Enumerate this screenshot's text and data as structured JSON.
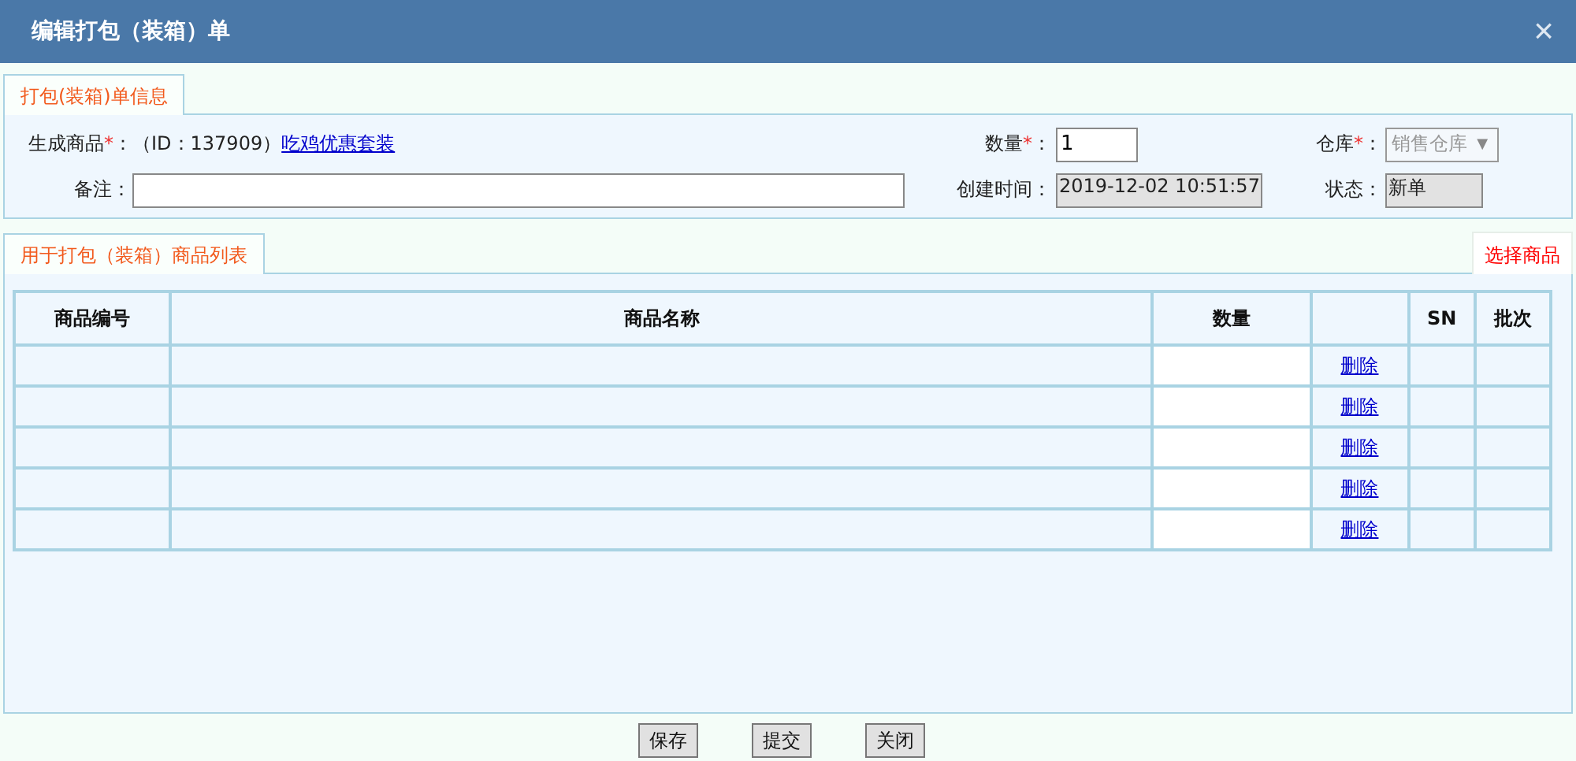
{
  "window": {
    "title": "编辑打包（装箱）单",
    "close": "×"
  },
  "info_tab": {
    "label": "打包(装箱)单信息",
    "selected": true
  },
  "product": {
    "label": "生成商品",
    "mark": "*",
    "sep": "：",
    "id_text": "（ID：137909）",
    "link": "吃鸡优惠套装"
  },
  "quantity": {
    "label": "数量",
    "mark": "*",
    "sep": "：",
    "value": "1"
  },
  "warehouse": {
    "label": "仓库",
    "mark": "*",
    "sep": "：",
    "value": "销售仓库",
    "arrow": "▼",
    "disabled": true
  },
  "remark": {
    "label": "备注："
  },
  "created": {
    "label": "创建时间：",
    "value": "2019-12-02 10:51:57"
  },
  "status": {
    "label": "状态：",
    "value": "新单"
  },
  "list_tab": {
    "label": "用于打包（装箱）商品列表",
    "selected": true
  },
  "select_link": "选择商品",
  "table": {
    "columns": [
      "商品编号",
      "商品名称",
      "数量",
      null,
      "SN",
      "批次"
    ],
    "rows": [
      {
        "action": "删除"
      },
      {
        "action": "删除"
      },
      {
        "action": "删除"
      },
      {
        "action": "删除"
      },
      {
        "action": "删除"
      }
    ]
  },
  "buttons": [
    "保存",
    "提交",
    "关闭"
  ]
}
